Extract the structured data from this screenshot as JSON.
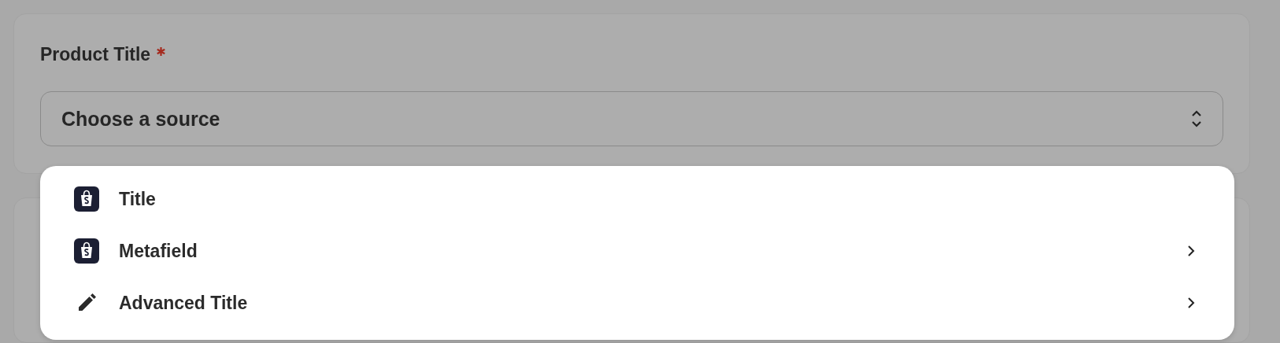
{
  "field": {
    "label": "Product Title",
    "required": true,
    "placeholder": "Choose a source"
  },
  "menu": {
    "items": [
      {
        "label": "Title",
        "kind": "store",
        "has_submenu": false
      },
      {
        "label": "Metafield",
        "kind": "store",
        "has_submenu": true
      },
      {
        "label": "Advanced Title",
        "kind": "edit",
        "has_submenu": true
      }
    ]
  }
}
